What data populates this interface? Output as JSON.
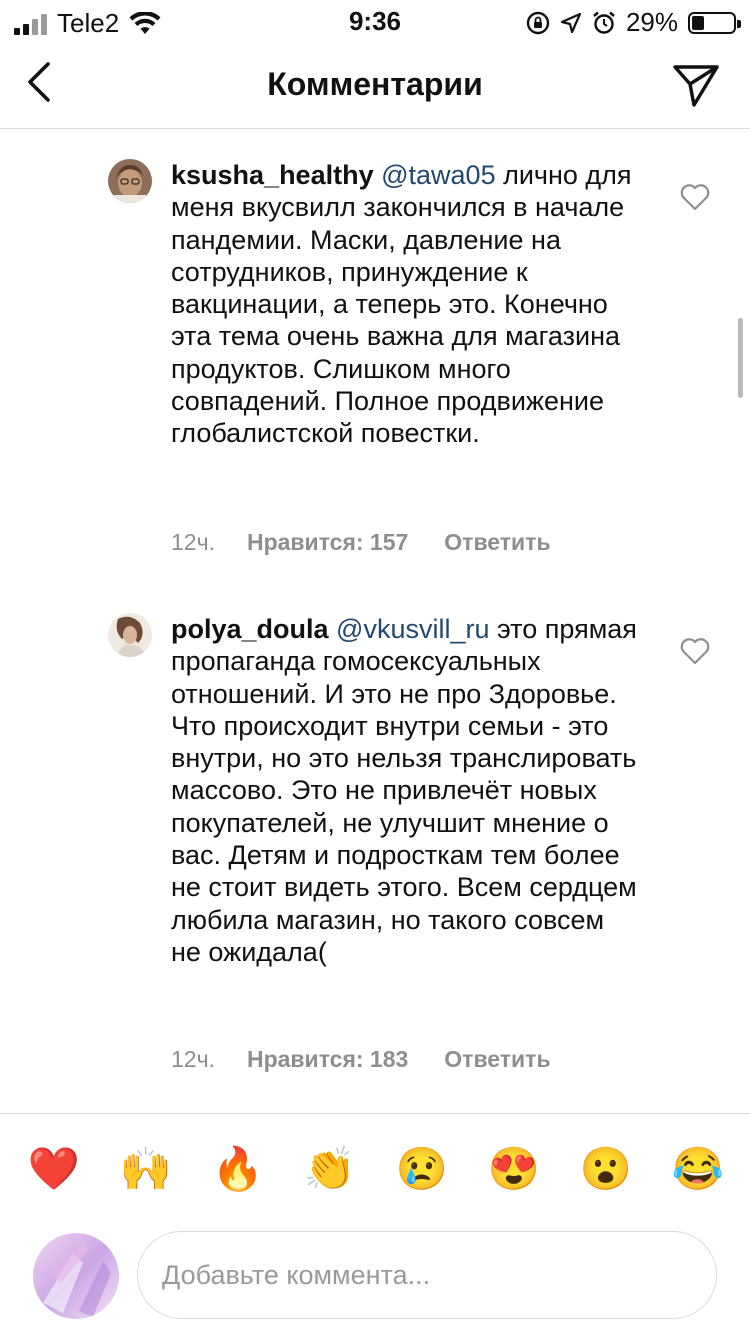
{
  "status_bar": {
    "carrier": "Tele2",
    "time": "9:36",
    "battery_percent": "29%",
    "battery_level": 0.29,
    "icons": [
      "signal-icon",
      "wifi-icon",
      "orientation-lock-icon",
      "location-icon",
      "alarm-icon",
      "battery-icon"
    ]
  },
  "nav": {
    "title": "Комментарии",
    "back_icon": "chevron-left-icon",
    "share_icon": "paper-plane-icon"
  },
  "comments": [
    {
      "username": "ksusha_healthy",
      "mention": "@tawa05",
      "text": " лично для меня вкусвилл закончился в начале пандемии. Маски, давление на сотрудников, принуждение к вакцинации, а теперь это. Конечно эта тема очень  важна для магазина продуктов. Слишком много совпадений. Полное продвижение глобалистской повестки.",
      "time_ago": "12ч.",
      "likes": "Нравится: 157",
      "reply": "Ответить"
    },
    {
      "username": "polya_doula",
      "mention": "@vkusvill_ru",
      "text": " это прямая пропаганда гомосексуальных отношений. И это не про Здоровье. Что происходит внутри семьи - это внутри, но это нельзя транслировать массово. Это не привлечёт новых покупателей, не улучшит мнение о вас. Детям и подросткам тем более не стоит видеть этого. Всем сердцем любила магазин, но такого совсем не ожидала(",
      "time_ago": "12ч.",
      "likes": "Нравится: 183",
      "reply": "Ответить"
    }
  ],
  "composer": {
    "emojis": [
      "❤️",
      "🙌",
      "🔥",
      "👏",
      "😢",
      "😍",
      "😮",
      "😂"
    ],
    "placeholder": "Добавьте коммента..."
  }
}
